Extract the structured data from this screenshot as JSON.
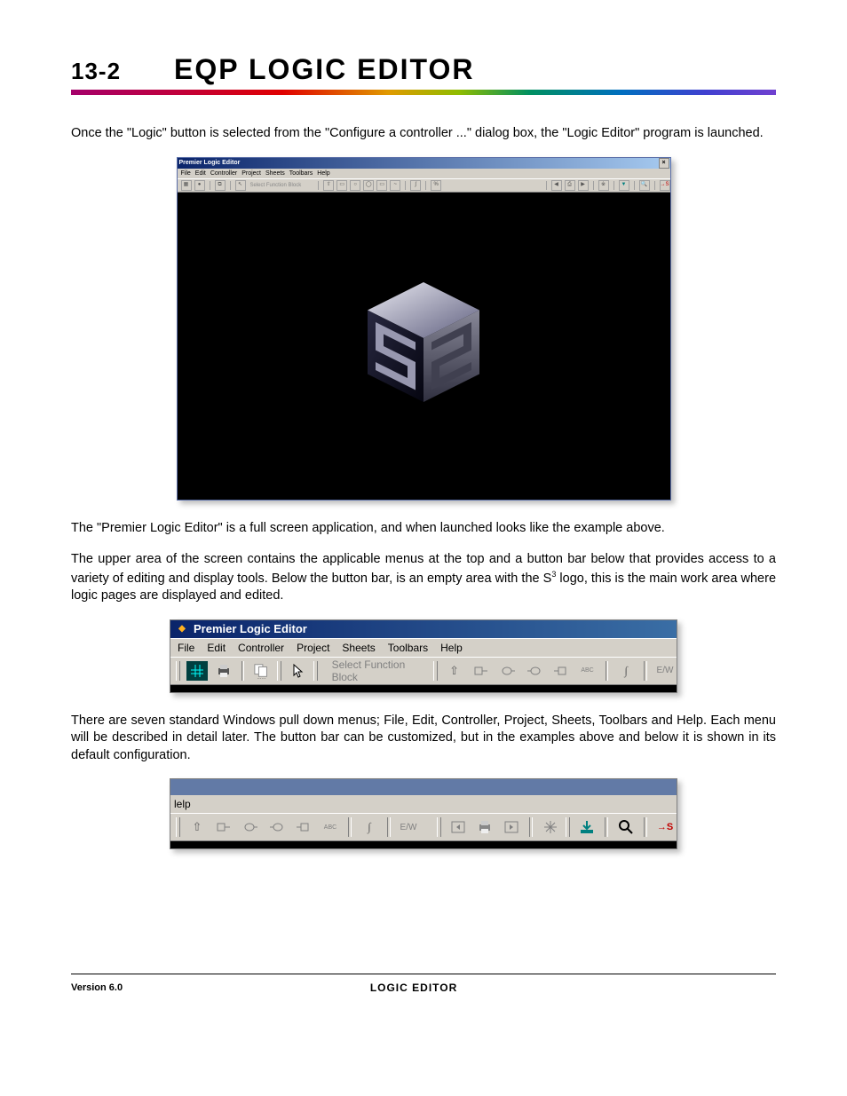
{
  "header": {
    "section_num": "13-2",
    "chapter_title": "EQP LOGIC EDITOR"
  },
  "body_text": {
    "p1": "Once the \"Logic\" button is selected from the \"Configure a controller ...\" dialog box, the \"Logic Editor\" program is launched.",
    "p2": "The \"Premier Logic Editor\" is a full screen application, and when launched looks like the example above.",
    "p3_pre": "The upper area of the screen contains the applicable menus at the top and a button bar below that provides access to a variety of editing and display tools.  Below the button bar, is an empty area with the S",
    "p3_sup": "3",
    "p3_post": " logo, this is the main work area where logic pages are displayed and edited.",
    "p4": "There are seven standard Windows pull down menus; File, Edit, Controller, Project, Sheets, Toolbars and Help. Each menu will be described in detail later.  The button bar can be customized, but in the examples above and below it is shown in its default configuration."
  },
  "screenshot1": {
    "title": "Premier Logic Editor",
    "menus": [
      "File",
      "Edit",
      "Controller",
      "Project",
      "Sheets",
      "Toolbars",
      "Help"
    ],
    "select_label": "Select Function Block"
  },
  "screenshot2": {
    "title": "Premier Logic Editor",
    "menus": [
      "File",
      "Edit",
      "Controller",
      "Project",
      "Sheets",
      "Toolbars",
      "Help"
    ],
    "select_label": "Select Function Block",
    "abc_label": "ABC",
    "ew_label": "E/W"
  },
  "screenshot3": {
    "menu_fragment": "lelp",
    "abc_label": "ABC",
    "ew_label": "E/W",
    "arrow_s_label": "→S"
  },
  "footer": {
    "version": "Version 6.0",
    "center": "LOGIC EDITOR"
  },
  "chart_data": null
}
